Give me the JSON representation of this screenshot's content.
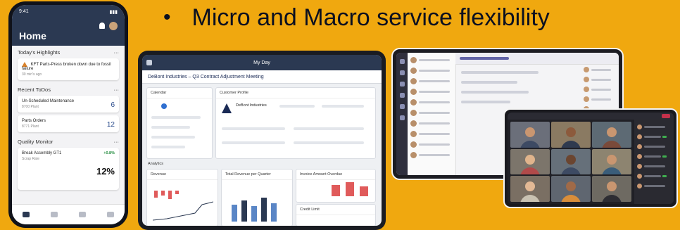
{
  "headline": {
    "bullet": "•",
    "text": "Micro and Macro service flexibility"
  },
  "phone": {
    "title": "Home",
    "sections": {
      "highlights": {
        "title": "Today's Highlights",
        "alert": "KFT Parts-Press broken down due to fossil failure",
        "alert_time": "30 min's ago"
      },
      "todos": {
        "title": "Recent ToDos",
        "items": [
          {
            "label": "Un-Scheduled Maintenance",
            "sub": "8700 Plant",
            "count": "6"
          },
          {
            "label": "Parts Orders",
            "sub": "8771 Plant",
            "count": "12"
          }
        ]
      },
      "quality": {
        "title": "Quality Monitor",
        "item": "Break Assembly GT1",
        "sub": "Scrap Rate",
        "trend": "+0.8%",
        "value": "12%"
      }
    }
  },
  "tablet": {
    "app_title": "My Day",
    "meeting": "DeBont Industries – Q3 Contract Adjustment Meeting",
    "panels": {
      "calendar": "Calendar",
      "customer": "Customer Profile",
      "company": "DeBont Industries",
      "analytics": "Analytics",
      "revenue": "Revenue",
      "forecast": "Total Revenue per Quarter",
      "orders": "Invoice Amount Overdue",
      "credit": "Credit Limit"
    }
  },
  "colors": {
    "background": "#f0a80f",
    "shell": "#2b3952",
    "accent_red": "#e05b5b",
    "teams_purple": "#6264a7"
  }
}
